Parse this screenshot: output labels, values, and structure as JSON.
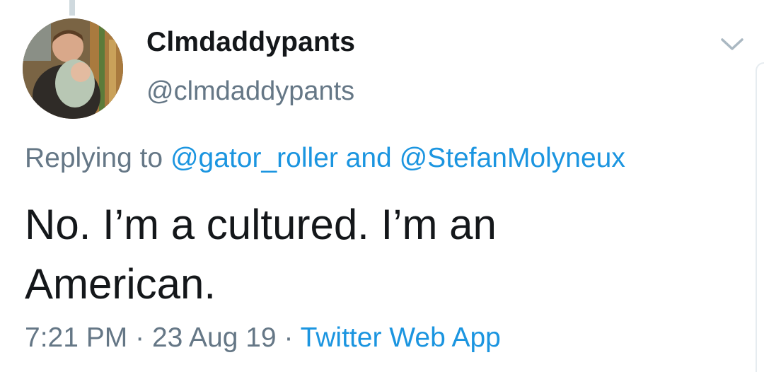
{
  "tweet": {
    "display_name": "Clmdaddypants",
    "handle": "@clmdaddypants",
    "replying_prefix": "Replying to",
    "mention_1": "@gator_roller",
    "reply_and": "and",
    "mention_2": "@StefanMolyneux",
    "text_line_1": "No. I’m a cultured. I’m an",
    "text_line_2": "American.",
    "time": "7:21 PM",
    "separator": "·",
    "date": "23 Aug 19",
    "source": "Twitter Web App"
  },
  "icons": {
    "menu": "chevron-down-icon",
    "avatar": "profile-avatar"
  },
  "colors": {
    "text_primary": "#14171a",
    "text_secondary": "#657786",
    "link": "#1b95e0",
    "divider": "#e6ecf0"
  }
}
